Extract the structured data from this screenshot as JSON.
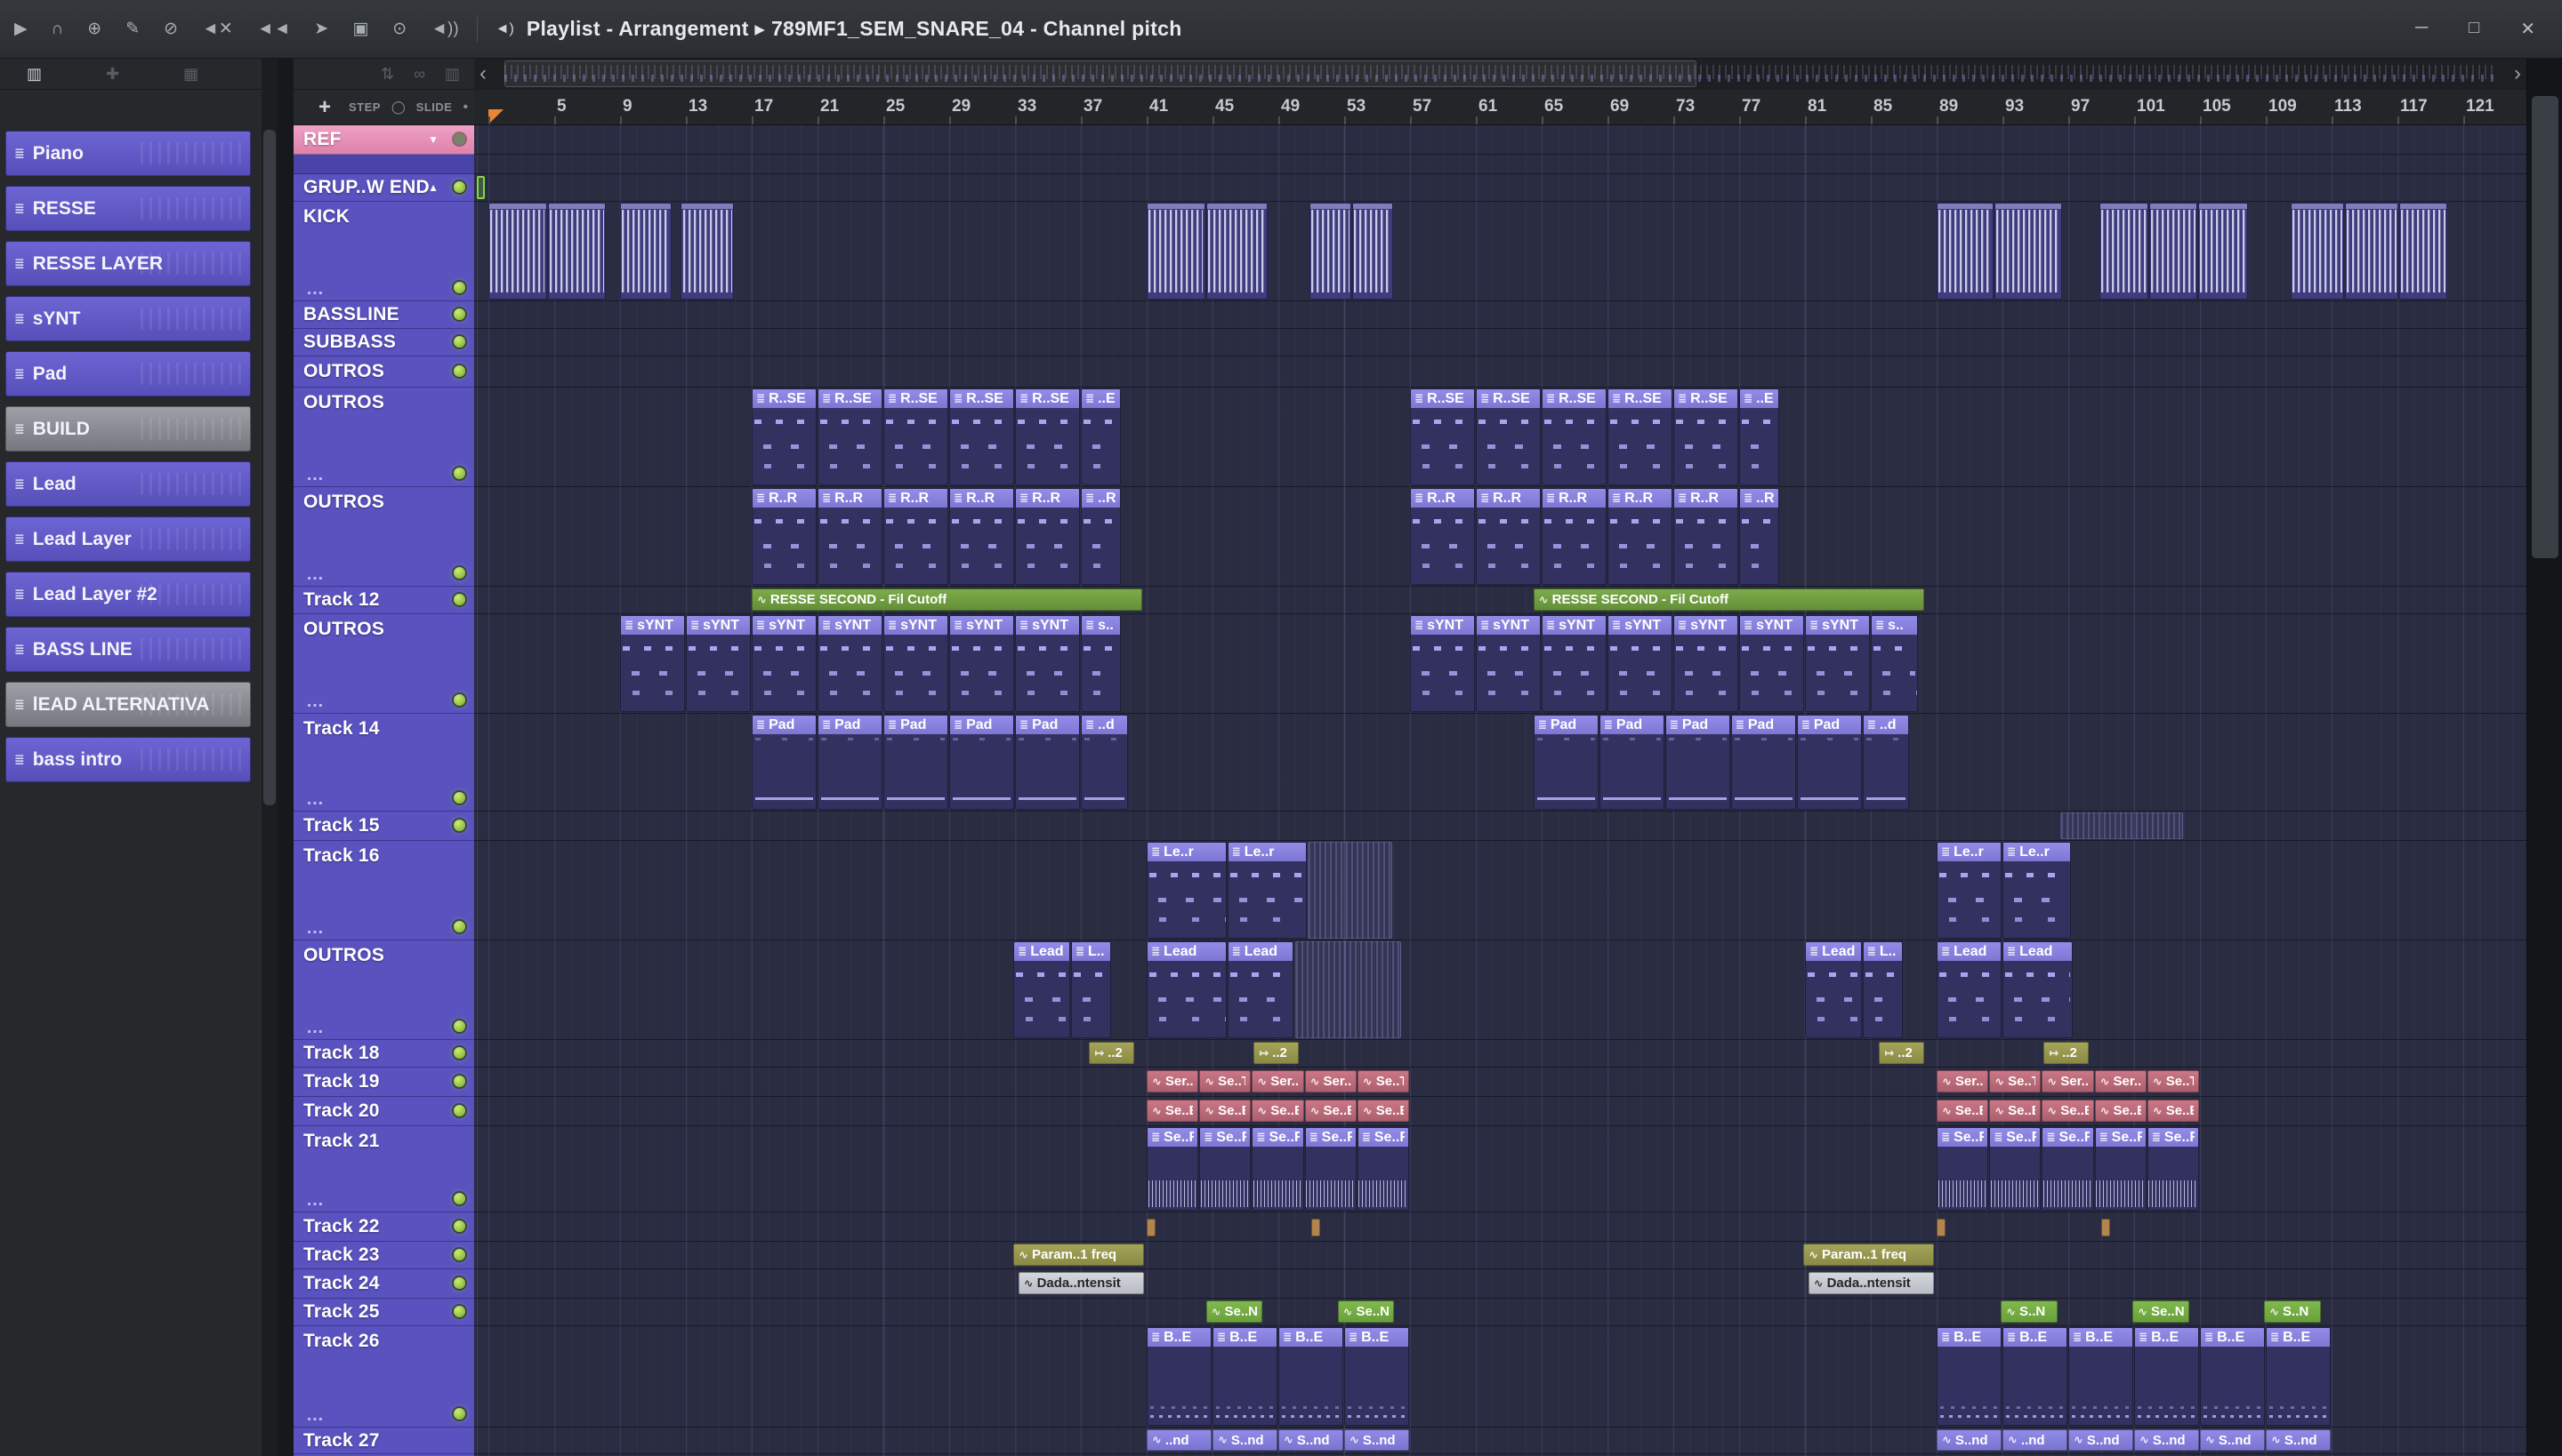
{
  "titlebar": {
    "icons": [
      {
        "name": "play-icon",
        "glyph": "▶"
      },
      {
        "name": "headphones-icon",
        "glyph": "∩"
      },
      {
        "name": "paperclip-icon",
        "glyph": "⊕"
      },
      {
        "name": "draw-icon",
        "glyph": "✎"
      },
      {
        "name": "disable-icon",
        "glyph": "⊘"
      },
      {
        "name": "mute-speaker-icon",
        "glyph": "◄✕"
      },
      {
        "name": "rewind-icon",
        "glyph": "◄◄"
      },
      {
        "name": "jump-icon",
        "glyph": "➤"
      },
      {
        "name": "selection-frame-icon",
        "glyph": "▣"
      },
      {
        "name": "zoom-icon",
        "glyph": "⊙"
      },
      {
        "name": "volume-icon",
        "glyph": "◄))"
      }
    ],
    "speaker_glyph": "◄)",
    "title": "Playlist - Arrangement  ▸  789MF1_SEM_SNARE_04 - Channel pitch",
    "window_controls": [
      {
        "name": "minimize-button",
        "glyph": "─"
      },
      {
        "name": "maximize-button",
        "glyph": "□"
      },
      {
        "name": "close-button",
        "glyph": "✕"
      }
    ]
  },
  "picker": {
    "header_icons": [
      {
        "name": "bricks-view-icon",
        "glyph": "▥"
      },
      {
        "name": "add-view-icon",
        "glyph": "✚"
      },
      {
        "name": "grid-view-icon",
        "glyph": "▦"
      }
    ],
    "items": [
      {
        "label": "Piano",
        "selected": false
      },
      {
        "label": "RESSE",
        "selected": false
      },
      {
        "label": "RESSE LAYER",
        "selected": false
      },
      {
        "label": "sYNT",
        "selected": false
      },
      {
        "label": "Pad",
        "selected": false
      },
      {
        "label": "BUILD",
        "selected": true
      },
      {
        "label": "Lead",
        "selected": false
      },
      {
        "label": "Lead Layer",
        "selected": false
      },
      {
        "label": "Lead Layer #2",
        "selected": false
      },
      {
        "label": "BASS LINE",
        "selected": false
      },
      {
        "label": "lEAD ALTERNATIVA",
        "selected": true
      },
      {
        "label": "bass intro",
        "selected": false
      }
    ]
  },
  "playlist": {
    "tools_top": [
      {
        "name": "arrange-icon",
        "glyph": "⇅"
      },
      {
        "name": "slide-link-icon",
        "glyph": "∞"
      },
      {
        "name": "layout-icon",
        "glyph": "▥"
      }
    ],
    "add_button": "+",
    "step_label": "STEP",
    "step_toggle_glyph": "◯",
    "slide_label": "SLIDE",
    "bullet": "•",
    "ellipsis": "…",
    "scroll_left": "‹",
    "scroll_right": "›",
    "pattern_selector": {
      "label": "REF",
      "arrow": "▼"
    },
    "ruler": {
      "first": 5,
      "interval": 4,
      "last": 121
    },
    "icons": {
      "pattern": "≣",
      "automation": "∿"
    },
    "tracks": [
      {
        "name": "REF",
        "type": "ref",
        "h": 33,
        "led": "dim"
      },
      {
        "type": "spacer",
        "h": 22
      },
      {
        "name": "GRUP..W END",
        "type": "group",
        "h": 31,
        "led": "mid"
      },
      {
        "name": "KICK",
        "h": 112,
        "led": "bottom",
        "kind": "audio",
        "clips": [
          [
            1,
            3.6
          ],
          [
            4.6,
            3.6
          ],
          [
            9,
            3.2
          ],
          [
            12.7,
            3.3
          ],
          [
            41,
            3.6
          ],
          [
            44.6,
            3.8
          ],
          [
            50.9,
            2.6
          ],
          [
            53.5,
            2.5
          ],
          [
            89,
            3.5
          ],
          [
            92.5,
            4.2
          ],
          [
            98.9,
            3
          ],
          [
            101.9,
            3
          ],
          [
            104.9,
            3.1
          ],
          [
            110.5,
            3.3
          ],
          [
            113.8,
            3.3
          ],
          [
            117.1,
            3
          ]
        ]
      },
      {
        "name": "BASSLINE",
        "h": 31,
        "led": "mid"
      },
      {
        "name": "SUBBASS",
        "h": 31,
        "led": "mid"
      },
      {
        "name": "OUTROS",
        "h": 35,
        "led": "mid"
      },
      {
        "name": "OUTROS",
        "h": 112,
        "led": "bottom",
        "kind": "pattern",
        "body": "notes",
        "clips": [
          [
            17,
            4,
            "R..SE"
          ],
          [
            21,
            4,
            "R..SE"
          ],
          [
            25,
            4,
            "R..SE"
          ],
          [
            29,
            4,
            "R..SE"
          ],
          [
            33,
            4,
            "R..SE"
          ],
          [
            37,
            2.5,
            "..E"
          ],
          [
            57,
            4,
            "R..SE"
          ],
          [
            61,
            4,
            "R..SE"
          ],
          [
            65,
            4,
            "R..SE"
          ],
          [
            69,
            4,
            "R..SE"
          ],
          [
            73,
            4,
            "R..SE"
          ],
          [
            77,
            2.5,
            "..E"
          ]
        ]
      },
      {
        "name": "OUTROS",
        "h": 112,
        "led": "bottom",
        "kind": "pattern",
        "body": "notes",
        "clips": [
          [
            17,
            4,
            "R..R"
          ],
          [
            21,
            4,
            "R..R"
          ],
          [
            25,
            4,
            "R..R"
          ],
          [
            29,
            4,
            "R..R"
          ],
          [
            33,
            4,
            "R..R"
          ],
          [
            37,
            2.5,
            "..R"
          ],
          [
            57,
            4,
            "R..R"
          ],
          [
            61,
            4,
            "R..R"
          ],
          [
            65,
            4,
            "R..R"
          ],
          [
            69,
            4,
            "R..R"
          ],
          [
            73,
            4,
            "R..R"
          ],
          [
            77,
            2.5,
            "..R"
          ]
        ]
      },
      {
        "name": "Track 12",
        "h": 31,
        "led": "mid",
        "kind": "auto-green",
        "clips": [
          [
            17,
            23.8,
            "RESSE SECOND - Fil Cutoff"
          ],
          [
            64.5,
            23.8,
            "RESSE SECOND - Fil Cutoff"
          ]
        ]
      },
      {
        "name": "OUTROS",
        "h": 112,
        "led": "bottom",
        "kind": "pattern",
        "body": "notes",
        "clips": [
          [
            9,
            4,
            "sYNT"
          ],
          [
            13,
            4,
            "sYNT"
          ],
          [
            17,
            4,
            "sYNT"
          ],
          [
            21,
            4,
            "sYNT"
          ],
          [
            25,
            4,
            "sYNT"
          ],
          [
            29,
            4,
            "sYNT"
          ],
          [
            33,
            4,
            "sYNT"
          ],
          [
            37,
            2.5,
            "s.."
          ],
          [
            57,
            4,
            "sYNT"
          ],
          [
            61,
            4,
            "sYNT"
          ],
          [
            65,
            4,
            "sYNT"
          ],
          [
            69,
            4,
            "sYNT"
          ],
          [
            73,
            4,
            "sYNT"
          ],
          [
            77,
            4,
            "sYNT"
          ],
          [
            81,
            4,
            "sYNT"
          ],
          [
            85,
            2.9,
            "s.."
          ]
        ]
      },
      {
        "name": "Track 14",
        "h": 110,
        "led": "bottom",
        "kind": "pattern",
        "body": "pad",
        "clips": [
          [
            17,
            4,
            "Pad"
          ],
          [
            21,
            4,
            "Pad"
          ],
          [
            25,
            4,
            "Pad"
          ],
          [
            29,
            4,
            "Pad"
          ],
          [
            33,
            4,
            "Pad"
          ],
          [
            37,
            2.9,
            "..d"
          ],
          [
            64.5,
            4,
            "Pad"
          ],
          [
            68.5,
            4,
            "Pad"
          ],
          [
            72.5,
            4,
            "Pad"
          ],
          [
            76.5,
            4,
            "Pad"
          ],
          [
            80.5,
            4,
            "Pad"
          ],
          [
            84.5,
            2.9,
            "..d"
          ]
        ]
      },
      {
        "name": "Track 15",
        "h": 33,
        "led": "mid",
        "kind": "pattern",
        "clips": [
          [
            96.5,
            7.5,
            "",
            "ghost"
          ]
        ]
      },
      {
        "name": "Track 16",
        "h": 112,
        "led": "bottom",
        "kind": "pattern",
        "body": "notes",
        "clips": [
          [
            41,
            4.9,
            "Le..r"
          ],
          [
            45.9,
            4.9,
            "Le..r"
          ],
          [
            50.8,
            5.2,
            "",
            "ghost"
          ],
          [
            89,
            4,
            "Le..r"
          ],
          [
            93,
            4.2,
            "Le..r"
          ]
        ]
      },
      {
        "name": "OUTROS",
        "h": 112,
        "led": "bottom",
        "kind": "pattern",
        "body": "notes",
        "clips": [
          [
            32.9,
            3.5,
            "Lead"
          ],
          [
            36.4,
            2.5,
            "L.."
          ],
          [
            41,
            4.9,
            "Lead"
          ],
          [
            45.9,
            4.1,
            "Lead"
          ],
          [
            50,
            6.5,
            "",
            "ghost"
          ],
          [
            81,
            3.5,
            "Lead"
          ],
          [
            84.5,
            2.5,
            "L.."
          ],
          [
            89,
            4,
            "Lead"
          ],
          [
            93,
            4.3,
            "Lead"
          ]
        ]
      },
      {
        "name": "Track 18",
        "h": 31,
        "led": "mid",
        "kind": "auto-olive",
        "icon": "↦",
        "clips": [
          [
            37.5,
            2.8,
            "..2"
          ],
          [
            47.5,
            2.8,
            "..2"
          ],
          [
            85.5,
            2.8,
            "..2"
          ],
          [
            95.5,
            2.8,
            "..2"
          ]
        ]
      },
      {
        "name": "Track 19",
        "h": 33,
        "led": "mid",
        "kind": "auto-pink",
        "clips": [
          [
            41,
            3.2,
            "Ser..T"
          ],
          [
            44.2,
            3.2,
            "Se..T"
          ],
          [
            47.4,
            3.2,
            "Ser..T"
          ],
          [
            50.6,
            3.2,
            "Ser..T"
          ],
          [
            53.8,
            3.2,
            "Se..T"
          ],
          [
            89,
            3.2,
            "Ser..T"
          ],
          [
            92.2,
            3.2,
            "Se..T"
          ],
          [
            95.4,
            3.2,
            "Ser..T"
          ],
          [
            98.6,
            3.2,
            "Ser..T"
          ],
          [
            101.8,
            3.2,
            "Se..T"
          ]
        ]
      },
      {
        "name": "Track 20",
        "h": 33,
        "led": "mid",
        "kind": "auto-pink",
        "clips": [
          [
            41,
            3.2,
            "Se..E"
          ],
          [
            44.2,
            3.2,
            "Se..E"
          ],
          [
            47.4,
            3.2,
            "Se..E"
          ],
          [
            50.6,
            3.2,
            "Se..E"
          ],
          [
            53.8,
            3.2,
            "Se..E"
          ],
          [
            89,
            3.2,
            "Se..E"
          ],
          [
            92.2,
            3.2,
            "Se..E"
          ],
          [
            95.4,
            3.2,
            "Se..E"
          ],
          [
            98.6,
            3.2,
            "Se..E"
          ],
          [
            101.8,
            3.2,
            "Se..E"
          ]
        ]
      },
      {
        "name": "Track 21",
        "h": 97,
        "led": "bottom",
        "kind": "pattern",
        "body": "wave",
        "clips": [
          [
            41,
            3.2,
            "Se..R"
          ],
          [
            44.2,
            3.2,
            "Se..R"
          ],
          [
            47.4,
            3.2,
            "Se..R"
          ],
          [
            50.6,
            3.2,
            "Se..R"
          ],
          [
            53.8,
            3.2,
            "Se..R"
          ],
          [
            89,
            3.2,
            "Se..R"
          ],
          [
            92.2,
            3.2,
            "Se..R"
          ],
          [
            95.4,
            3.2,
            "Se..R"
          ],
          [
            98.6,
            3.2,
            "Se..R"
          ],
          [
            101.8,
            3.2,
            "Se..R"
          ]
        ]
      },
      {
        "name": "Track 22",
        "h": 33,
        "led": "mid",
        "kind": "marker",
        "clips": [
          [
            41,
            0.5
          ],
          [
            51,
            0.5
          ],
          [
            89,
            0.5
          ],
          [
            99,
            0.5
          ]
        ]
      },
      {
        "name": "Track 23",
        "h": 31,
        "led": "mid",
        "kind": "auto-olive",
        "clips": [
          [
            32.9,
            8,
            "Param..1 freq"
          ],
          [
            80.9,
            8,
            "Param..1 freq"
          ]
        ]
      },
      {
        "name": "Track 24",
        "h": 33,
        "led": "mid",
        "kind": "auto-gray",
        "clips": [
          [
            33.2,
            7.7,
            "Dada..ntensit"
          ],
          [
            81.2,
            7.7,
            "Dada..ntensit"
          ]
        ]
      },
      {
        "name": "Track 25",
        "h": 31,
        "led": "mid",
        "kind": "auto-green2",
        "clips": [
          [
            44.6,
            3.5,
            "Se..N"
          ],
          [
            52.6,
            3.5,
            "Se..N"
          ],
          [
            92.9,
            3.5,
            "S..N"
          ],
          [
            100.9,
            3.5,
            "Se..N"
          ],
          [
            108.9,
            3.5,
            "S..N"
          ]
        ]
      },
      {
        "name": "Track 26",
        "h": 114,
        "led": "bottom",
        "kind": "pattern",
        "body": "dots",
        "clips": [
          [
            41,
            4,
            "B..E"
          ],
          [
            45,
            4,
            "B..E"
          ],
          [
            49,
            4,
            "B..E"
          ],
          [
            53,
            4,
            "B..E"
          ],
          [
            89,
            4,
            "B..E"
          ],
          [
            93,
            4,
            "B..E"
          ],
          [
            97,
            4,
            "B..E"
          ],
          [
            101,
            4,
            "B..E"
          ],
          [
            105,
            4,
            "B..E"
          ],
          [
            109,
            4,
            "B..E"
          ]
        ]
      },
      {
        "name": "Track 27",
        "h": 30,
        "led": "none",
        "kind": "auto-purple",
        "clips": [
          [
            41,
            4,
            "..nd"
          ],
          [
            45,
            4,
            "S..nd"
          ],
          [
            49,
            4,
            "S..nd"
          ],
          [
            53,
            4,
            "S..nd"
          ],
          [
            89,
            4,
            "S..nd"
          ],
          [
            93,
            4,
            "..nd"
          ],
          [
            97,
            4,
            "S..nd"
          ],
          [
            101,
            4,
            "S..nd"
          ],
          [
            105,
            4,
            "S..nd"
          ],
          [
            109,
            4,
            "S..nd"
          ]
        ]
      }
    ]
  },
  "colors": {
    "track_purple": "#5a52bf",
    "clip_header_purple": "#8a84e2",
    "automation_green": "#6f9f3e",
    "automation_pink": "#bf6f7e",
    "automation_olive": "#9a9a50",
    "automation_gray": "#ccd0d6",
    "automation_green_bright": "#76ad46",
    "ref_pink": "#e791b8",
    "led_green": "#a6d74e",
    "grid_bg": "#2a2c41",
    "playhead_orange": "#e98636"
  }
}
